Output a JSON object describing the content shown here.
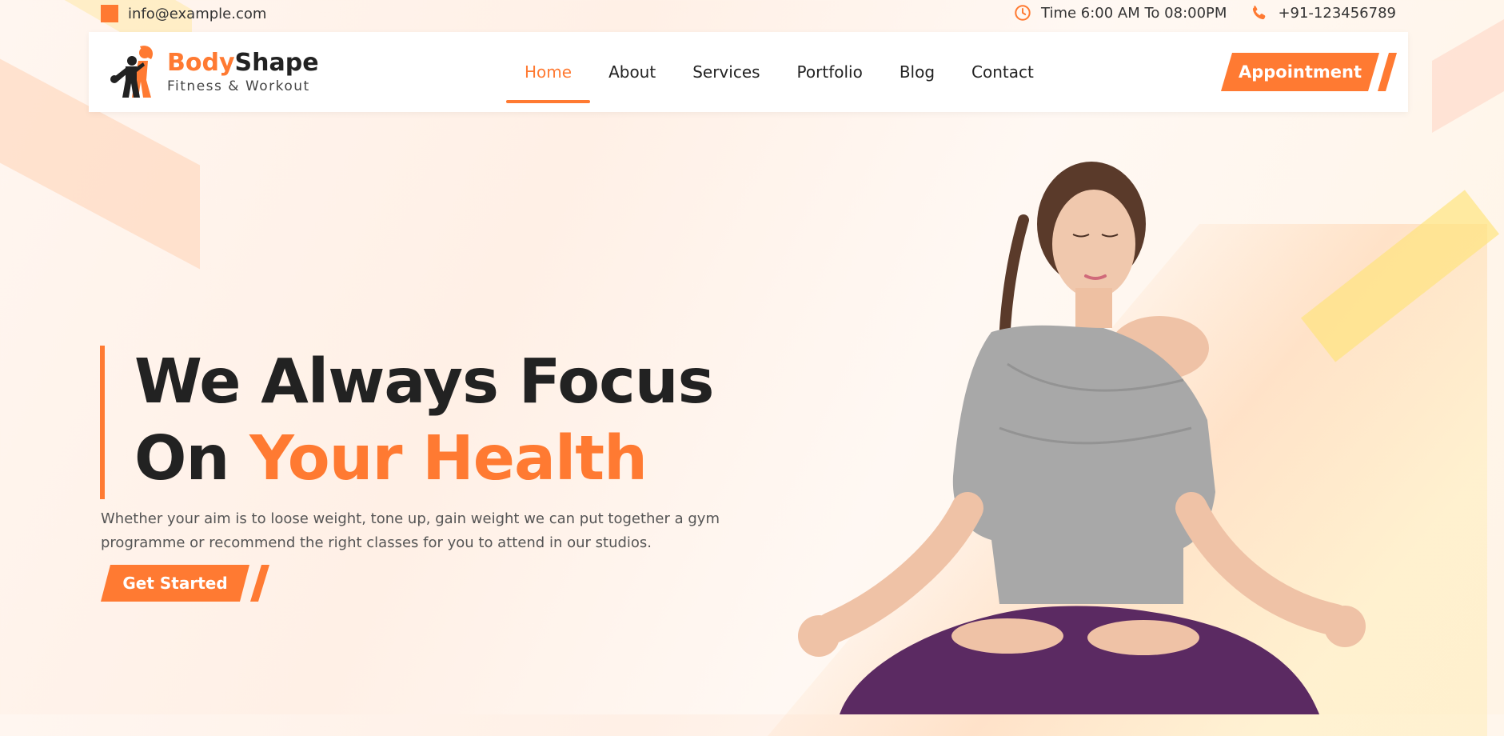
{
  "topbar": {
    "email": "info@example.com",
    "hours": "Time 6:00 AM To 08:00PM",
    "phone": "+91-123456789"
  },
  "logo": {
    "brand_part1": "Body",
    "brand_part2": "Shape",
    "tagline": "Fitness & Workout"
  },
  "nav": {
    "items": [
      {
        "label": "Home",
        "active": true
      },
      {
        "label": "About"
      },
      {
        "label": "Services"
      },
      {
        "label": "Portfolio"
      },
      {
        "label": "Blog"
      },
      {
        "label": "Contact"
      }
    ],
    "appointment_label": "Appointment"
  },
  "hero": {
    "title_line1": "We Always Focus",
    "title_line2_a": "On ",
    "title_line2_b": "Your Health",
    "description": "Whether your aim is to loose weight, tone up, gain weight we can put together a gym programme or recommend the right classes for you to attend in our studios.",
    "cta_label": "Get Started"
  },
  "icons": {
    "email": "square-icon",
    "hours": "clock-icon",
    "phone": "phone-icon"
  },
  "colors": {
    "accent": "#ff7a32",
    "text": "#222222"
  }
}
